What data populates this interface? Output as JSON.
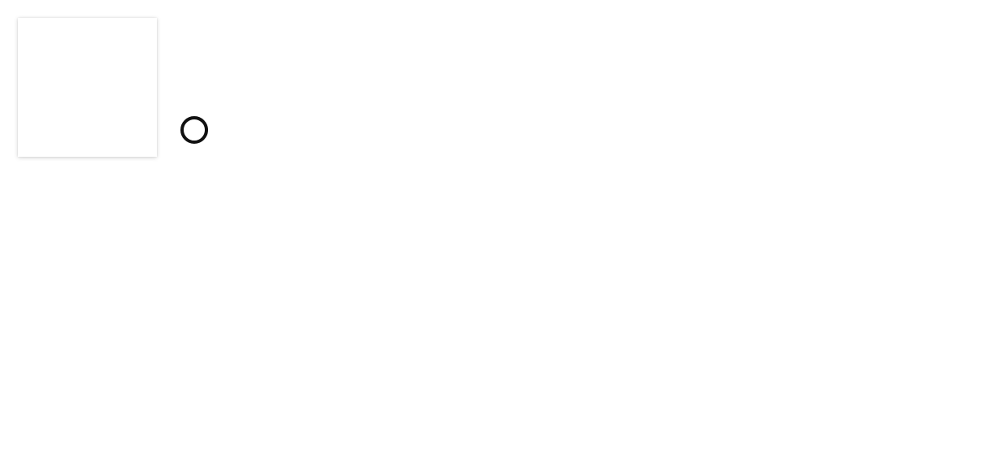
{
  "tile": {
    "label": ""
  },
  "radio": {
    "selected": false
  },
  "colors": {
    "background": "#ffffff",
    "radio_stroke": "#111111"
  }
}
